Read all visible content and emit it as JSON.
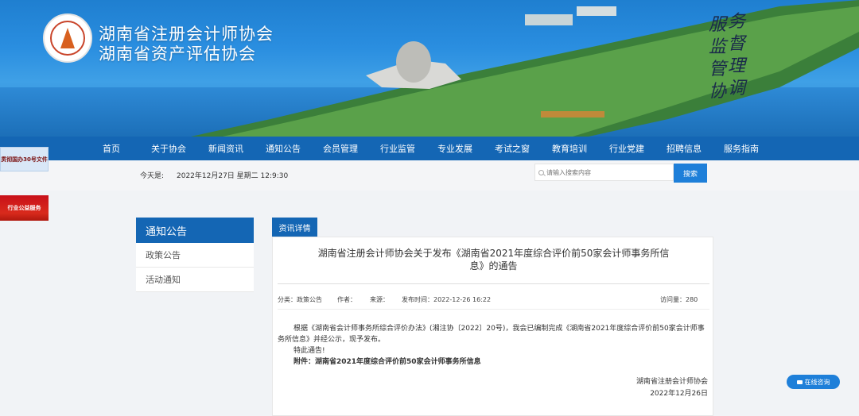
{
  "header": {
    "org_name_1": "湖南省注册会计师协会",
    "org_name_2": "湖南省资产评估协会",
    "slogan_col1": [
      "服",
      "监",
      "管",
      "协"
    ],
    "slogan_col2": [
      "务",
      "督",
      "理",
      "调"
    ]
  },
  "nav": {
    "items": [
      "首页",
      "关于协会",
      "新闻资讯",
      "通知公告",
      "会员管理",
      "行业监管",
      "专业发展",
      "考试之窗",
      "教育培训",
      "行业党建",
      "招聘信息",
      "服务指南"
    ]
  },
  "infobar": {
    "date_label": "今天是:",
    "date_value": "2022年12月27日 星期二 12:9:30",
    "search_placeholder": "请输入搜索内容",
    "search_button": "搜索"
  },
  "ads": {
    "doc": "贯彻国办30号文件",
    "public": "行业公益服务"
  },
  "sidebar": {
    "title": "通知公告",
    "items": [
      "政策公告",
      "活动通知"
    ]
  },
  "article": {
    "tab": "资讯详情",
    "title": "湖南省注册会计师协会关于发布《湖南省2021年度综合评价前50家会计师事务所信息》的通告",
    "category": "分类：政策公告",
    "author": "作者：",
    "source": "来源：",
    "publish_time": "发布时间：2022-12-26 16:22",
    "visits": "访问量：280",
    "paragraph_1": "根据《湖南省会计师事务所综合评价办法》(湘注协〔2022〕20号)，我会已编制完成《湖南省2021年度综合评价前50家会计师事务所信息》并经公示，现予发布。",
    "paragraph_2": "特此通告!",
    "attachment": "附件：湖南省2021年度综合评价前50家会计师事务所信息",
    "sign_org": "湖南省注册会计师协会",
    "sign_date": "2022年12月26日"
  },
  "consult": {
    "label": "在线咨询"
  },
  "colors": {
    "nav_blue": "#1466b4",
    "button_blue": "#1e7fd9",
    "ad_red": "#c8101a"
  }
}
